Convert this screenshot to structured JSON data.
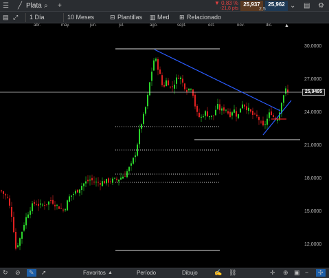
{
  "window": {
    "instrument": "Plata",
    "add_label": "+"
  },
  "quote": {
    "change_pct": "▼ 0,83 %",
    "change_pts": "-21,8 pts",
    "bid": "25,937",
    "ask": "25,962",
    "spread": "2,5"
  },
  "toolbar": {
    "timeframe": "1 Día",
    "range": "10 Meses",
    "templates": "Plantillas",
    "type": "Med",
    "related": "Relacionado"
  },
  "months": [
    "abr.",
    "may.",
    "jun.",
    "jul.",
    "ago.",
    "sept.",
    "oct.",
    "nov.",
    "dic."
  ],
  "chart_data": {
    "type": "candlestick",
    "yticks": [
      "30,0000",
      "27,0000",
      "24,0000",
      "21,0000",
      "18,0000",
      "15,0000",
      "12,0000"
    ],
    "current_price": "25,9495",
    "ylim": [
      10.5,
      30.7
    ]
  },
  "bottombar": {
    "favorites": "Favoritos",
    "period": "Período",
    "drawing": "Dibujo"
  },
  "colors": {
    "up": "#2bd52b",
    "down": "#e02020",
    "trend": "#2a5cff"
  }
}
